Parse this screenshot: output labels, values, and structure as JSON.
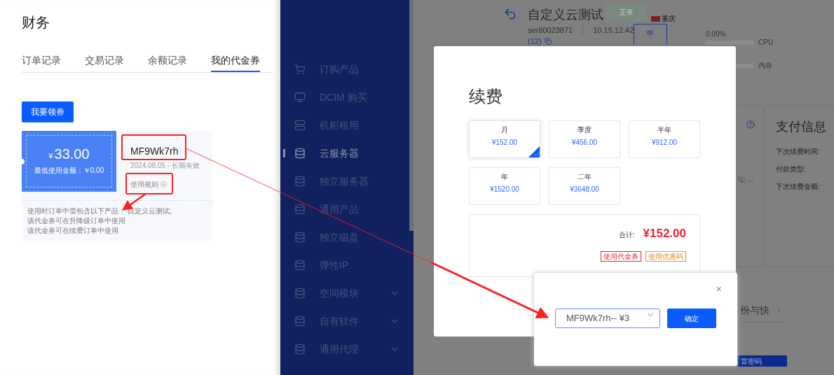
{
  "finance_page": {
    "title": "财务",
    "tabs": [
      {
        "label": "订单记录",
        "selected": false
      },
      {
        "label": "交易记录",
        "selected": false
      },
      {
        "label": "余额记录",
        "selected": false
      },
      {
        "label": "我的代金券",
        "selected": true
      }
    ],
    "claim_button": "我要领券",
    "coupon": {
      "currency": "¥",
      "amount": "33.00",
      "min_spend": "最低使用金额：￥0.00",
      "code": "MF9Wk7rh",
      "validity": "2024.08.05 - 长期有效",
      "rules_link": "使用规则",
      "rules": [
        "使用时订单中需包含以下产品： 自定义云测试;",
        "该代金券可在升降级订单中使用",
        "该代金券可在续费订单中使用"
      ]
    }
  },
  "console": {
    "sidebar": {
      "items": [
        {
          "kind": "cart",
          "label": "订购产品",
          "selected": false,
          "expandable": false
        },
        {
          "kind": "monitor",
          "label": "DCIM 购买",
          "selected": false,
          "expandable": false
        },
        {
          "kind": "rack",
          "label": "机柜租用",
          "selected": false,
          "expandable": false
        },
        {
          "kind": "database",
          "label": "云服务器",
          "selected": true,
          "expandable": false
        },
        {
          "kind": "database",
          "label": "独立服务器",
          "selected": false,
          "expandable": false
        },
        {
          "kind": "database",
          "label": "通用产品",
          "selected": false,
          "expandable": false
        },
        {
          "kind": "database",
          "label": "独立磁盘",
          "selected": false,
          "expandable": false
        },
        {
          "kind": "database",
          "label": "弹性IP",
          "selected": false,
          "expandable": false
        },
        {
          "kind": "database",
          "label": "空间模块",
          "selected": false,
          "expandable": true
        },
        {
          "kind": "database",
          "label": "自有软件",
          "selected": false,
          "expandable": true
        },
        {
          "kind": "database",
          "label": "通用代理",
          "selected": false,
          "expandable": true
        }
      ]
    },
    "server": {
      "title": "自定义云测试",
      "status": "正常",
      "region": "重庆",
      "id": "ser80023871",
      "ip": "10.15.12.42",
      "count": "(12)",
      "apply_button": "申",
      "cpu_usage": "0.00%",
      "cpu_label": "CPU",
      "memory_label": "内存",
      "hidden_value": "..."
    },
    "payment_info": {
      "title": "支付信息",
      "fields": [
        "下次续费时间:",
        "付款类型:",
        "下次续费金额:"
      ]
    },
    "backup_heading": "份与快",
    "reset_password": "置密码"
  },
  "renew_modal": {
    "title": "续费",
    "options": [
      {
        "period": "月",
        "price": "¥152.00",
        "selected": true
      },
      {
        "period": "季度",
        "price": "¥456.00",
        "selected": false
      },
      {
        "period": "半年",
        "price": "¥912.00",
        "selected": false
      },
      {
        "period": "年",
        "price": "¥1520.00",
        "selected": false
      },
      {
        "period": "二年",
        "price": "¥3648.00",
        "selected": false
      }
    ],
    "total_label": "合计:",
    "total": "¥152.00",
    "voucher_button": "使用代金券",
    "promo_button": "使用优惠码"
  },
  "voucher_dialog": {
    "selected_voucher": "MF9Wk7rh-- ¥3",
    "confirm_button": "确定",
    "close": "×"
  }
}
